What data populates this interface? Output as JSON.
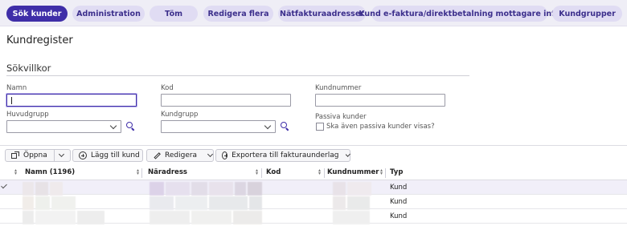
{
  "tabs": [
    {
      "label": "Sök kunder",
      "active": true
    },
    {
      "label": "Administration"
    },
    {
      "label": "Töm"
    },
    {
      "label": "Redigera flera"
    },
    {
      "label": "Nätfakturaadresser"
    },
    {
      "label": "Kund e-faktura/direktbetalning mottagare info"
    },
    {
      "label": "Kundgrupper"
    }
  ],
  "page_title": "Kundregister",
  "search": {
    "section_title": "Sökvillkor",
    "namn_label": "Namn",
    "namn_value": "",
    "kod_label": "Kod",
    "kod_value": "",
    "kundnummer_label": "Kundnummer",
    "kundnummer_value": "",
    "huvudgrupp_label": "Huvudgrupp",
    "huvudgrupp_value": "",
    "kundgrupp_label": "Kundgrupp",
    "kundgrupp_value": "",
    "passiva_label": "Passiva kunder",
    "passiva_checkbox_label": "Ska även passiva kunder visas?",
    "passiva_checked": false
  },
  "toolbar": {
    "open_label": "Öppna",
    "add_label": "Lägg till kund",
    "edit_label": "Redigera",
    "export_label": "Exportera till fakturaunderlag"
  },
  "table": {
    "columns": [
      "Namn (1196)",
      "Näradress",
      "Kod",
      "Kundnummer",
      "Typ"
    ],
    "rows": [
      {
        "typ": "Kund",
        "selected": true
      },
      {
        "typ": "Kund"
      },
      {
        "typ": "Kund"
      }
    ]
  },
  "colors": {
    "accent": "#3f2ea8",
    "tab_bg": "#e0dcf3",
    "tabbar_bg": "#efeef6",
    "selected_row": "#f1eff9"
  },
  "icons": [
    "search-icon",
    "open-icon",
    "add-icon",
    "edit-icon",
    "export-icon",
    "chevron-down-icon",
    "check-icon"
  ]
}
